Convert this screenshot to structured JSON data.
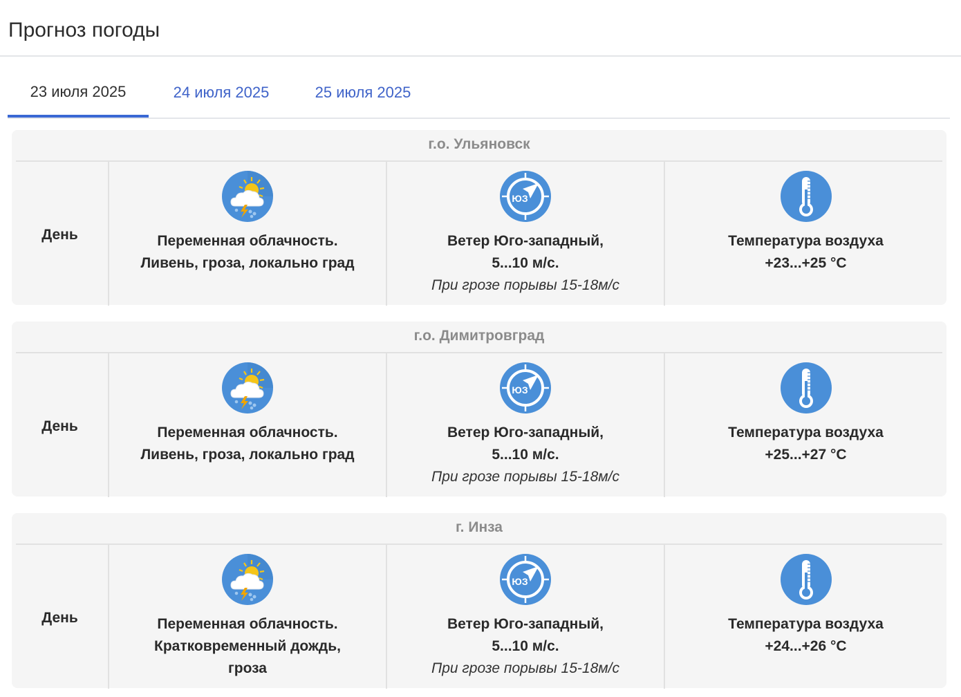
{
  "header": {
    "title": "Прогноз погоды"
  },
  "tabs": [
    {
      "label": "23 июля 2025",
      "active": true
    },
    {
      "label": "24 июля 2025",
      "active": false
    },
    {
      "label": "25 июля 2025",
      "active": false
    }
  ],
  "colors": {
    "accent": "#3a68d4",
    "icon_blue": "#4a8fd8",
    "card_bg": "#f5f5f5"
  },
  "forecasts": [
    {
      "city": "г.о. Ульяновск",
      "period": "День",
      "weather_icon": "cloud-sun-thunder-icon",
      "weather": [
        "Переменная облачность.",
        "Ливень, гроза, локально град"
      ],
      "wind_icon": "wind-compass-sw-icon",
      "wind_icon_label": "ЮЗ",
      "wind": [
        "Ветер Юго-западный,",
        "5...10 м/с."
      ],
      "wind_note": "При грозе порывы 15-18м/с",
      "temp_icon": "thermometer-icon",
      "temp": [
        "Температура воздуха",
        "+23...+25 °С"
      ]
    },
    {
      "city": "г.о. Димитровград",
      "period": "День",
      "weather_icon": "cloud-sun-thunder-icon",
      "weather": [
        "Переменная облачность.",
        "Ливень, гроза, локально град"
      ],
      "wind_icon": "wind-compass-sw-icon",
      "wind_icon_label": "ЮЗ",
      "wind": [
        "Ветер Юго-западный,",
        "5...10 м/с."
      ],
      "wind_note": "При грозе порывы 15-18м/с",
      "temp_icon": "thermometer-icon",
      "temp": [
        "Температура воздуха",
        "+25...+27 °С"
      ]
    },
    {
      "city": "г. Инза",
      "period": "День",
      "weather_icon": "cloud-sun-thunder-icon",
      "weather": [
        "Переменная облачность.",
        "Кратковременный дождь,",
        "гроза"
      ],
      "wind_icon": "wind-compass-sw-icon",
      "wind_icon_label": "ЮЗ",
      "wind": [
        "Ветер Юго-западный,",
        "5...10 м/с."
      ],
      "wind_note": "При грозе порывы 15-18м/с",
      "temp_icon": "thermometer-icon",
      "temp": [
        "Температура воздуха",
        "+24...+26 °С"
      ]
    }
  ]
}
